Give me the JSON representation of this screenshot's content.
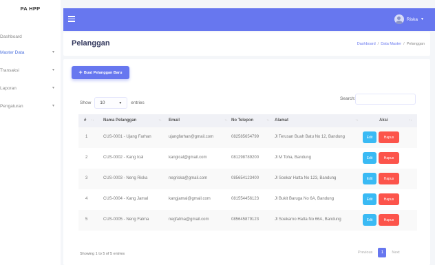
{
  "sidebar": {
    "brand": "PA HPP",
    "items": [
      {
        "label": "Dashboard",
        "has_caret": false,
        "active": false
      },
      {
        "label": "Master Data",
        "has_caret": true,
        "active": true
      },
      {
        "label": "Transaksi",
        "has_caret": true,
        "active": false
      },
      {
        "label": "Laporan",
        "has_caret": true,
        "active": false
      },
      {
        "label": "Pengaturan",
        "has_caret": true,
        "active": false
      }
    ],
    "caret": "▾"
  },
  "topbar": {
    "user_name": "Riska",
    "user_caret": "▼",
    "accent_color": "#6777ef"
  },
  "header": {
    "title": "Pelanggan",
    "breadcrumb": [
      "Dashboard",
      "Data Master",
      "Pelanggan"
    ],
    "separator": "/"
  },
  "main": {
    "new_button_label": "Buat Pelanggan Baru",
    "show_label": "Show",
    "entries_value": "10",
    "entries_label": "entries",
    "search_label": "Search:",
    "search_value": "",
    "columns": [
      "#",
      "Nama Pelanggan",
      "Email",
      "No Telepon",
      "Alamat",
      "Aksi"
    ],
    "rows": [
      {
        "no": "1",
        "name": "CUS-0001 - Ujang Farhan",
        "email": "ujangfarhan@gmail.com",
        "phone": "082585654799",
        "address": "Jl Terusan Buah Batu No 12, Bandung"
      },
      {
        "no": "2",
        "name": "CUS-0002 - Kang Ical",
        "email": "kangical@gmail.com",
        "phone": "081298789200",
        "address": "Jl M Toha, Bandung"
      },
      {
        "no": "3",
        "name": "CUS-0003 - Neng Riska",
        "email": "negriska@gmail.com",
        "phone": "085654123400",
        "address": "Jl Soekar Hatta No 123, Bandung"
      },
      {
        "no": "4",
        "name": "CUS-0004 - Kang Jamal",
        "email": "kangjamal@gmail.com",
        "phone": "081554456123",
        "address": "Jl Bukit Baruga No 6A, Bandung"
      },
      {
        "no": "5",
        "name": "CUS-0005 - Neng Fatma",
        "email": "negfatma@gmail.com",
        "phone": "085645879123",
        "address": "Jl Soekarno Hatta No 66A, Bandung"
      }
    ],
    "edit_label": "Edit",
    "delete_label": "Hapus",
    "info_text": "Showing 1 to 5 of 5 entries",
    "pagination": {
      "prev": "Previous",
      "current": "1",
      "next": "Next"
    }
  }
}
